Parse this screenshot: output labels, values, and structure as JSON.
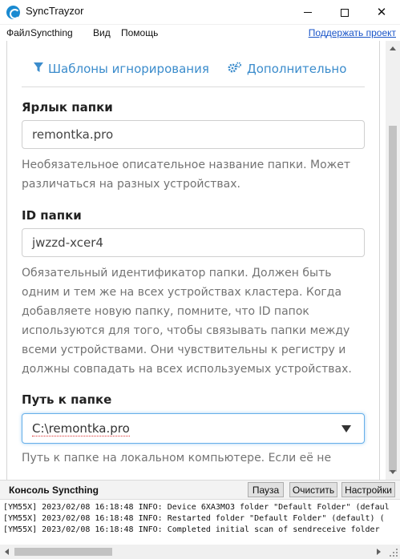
{
  "window": {
    "title": "SyncTrayzor"
  },
  "menu": {
    "items": [
      "Файл",
      "Syncthing",
      "Вид",
      "Помощь"
    ],
    "support_link": "Поддержать проект"
  },
  "tabs": {
    "ignore_patterns": {
      "label": "Шаблоны игнорирования",
      "icon": "filter-icon"
    },
    "advanced": {
      "label": "Дополнительно",
      "icon": "gears-icon"
    }
  },
  "form": {
    "folder_label": {
      "label": "Ярлык папки",
      "value": "remontka.pro",
      "help": "Необязательное описательное название папки. Может различаться на разных устройствах."
    },
    "folder_id": {
      "label": "ID папки",
      "value": "jwzzd-xcer4",
      "help": "Обязательный идентификатор папки. Должен быть одним и тем же на всех устройствах кластера. Когда добавляете новую папку, помните, что ID папок используются для того, чтобы связывать папки между всеми устройствами. Они чувствительны к регистру и должны совпадать на всех используемых устройствах."
    },
    "folder_path": {
      "label": "Путь к папке",
      "value": "C:\\remontka.pro",
      "help": "Путь к папке на локальном компьютере. Если её не"
    }
  },
  "console": {
    "title": "Консоль Syncthing",
    "buttons": {
      "pause": "Пауза",
      "clear": "Очистить",
      "settings": "Настройки"
    },
    "lines": [
      "[YM55X] 2023/02/08 16:18:48 INFO: Device 6XA3MO3 folder \"Default Folder\" (defaul",
      "[YM55X] 2023/02/08 16:18:48 INFO: Restarted folder \"Default Folder\" (default) (",
      "[YM55X] 2023/02/08 16:18:48 INFO: Completed initial scan of sendreceive folder"
    ]
  },
  "colors": {
    "accent": "#3b8ccc",
    "link": "#1a55c8",
    "help_text": "#737373",
    "focus_border": "#66afe9"
  }
}
